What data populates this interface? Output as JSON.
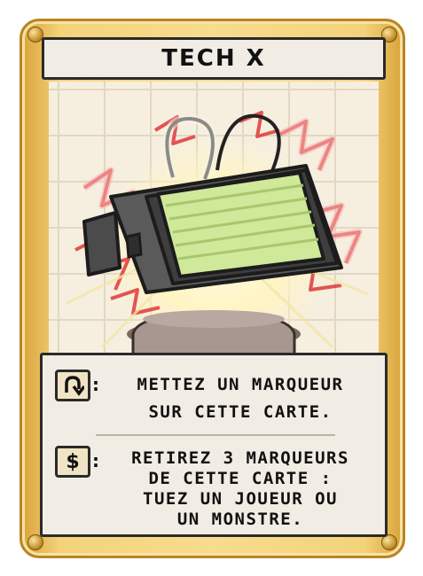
{
  "card": {
    "title": "TECH X",
    "abilities": [
      {
        "icon": "tap-arrow-icon",
        "lines": [
          "METTEZ UN MARQUEUR",
          "SUR CETTE CARTE."
        ]
      },
      {
        "icon": "dollar-icon",
        "icon_glyph": "$",
        "lines": [
          "RETIREZ 3 MARQUEURS",
          "DE CETTE CARTE :",
          "TUEZ UN JOUEUR OU",
          "UN MONSTRE."
        ]
      }
    ],
    "colon": ":"
  },
  "colors": {
    "frame_gold": "#f3d27a",
    "frame_edge": "#b98426",
    "banner_bg": "#f1ede4",
    "screen_green": "#cfe89a",
    "lightning_red": "#e03a3a"
  }
}
